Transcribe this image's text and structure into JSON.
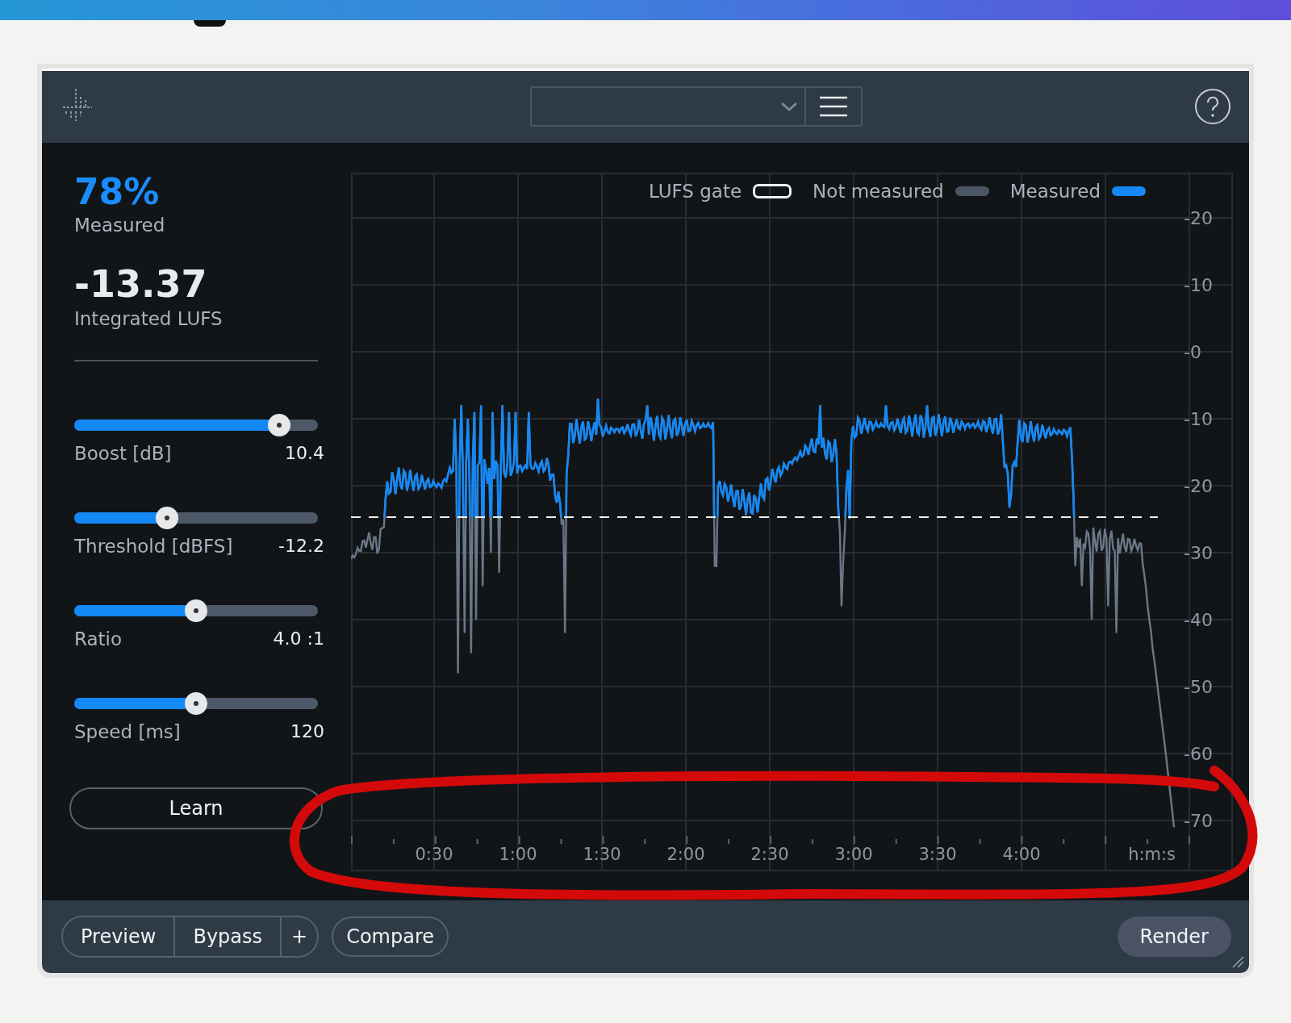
{
  "stats": {
    "percent": "78%",
    "percent_label": "Measured",
    "value": "-13.37",
    "value_label": "Integrated LUFS"
  },
  "sliders": [
    {
      "label": "Boost [dB]",
      "value": "10.4",
      "level": 0.84
    },
    {
      "label": "Threshold [dBFS]",
      "value": "-12.2",
      "level": 0.38
    },
    {
      "label": "Ratio",
      "value": "4.0 :1",
      "level": 0.5
    },
    {
      "label": "Speed [ms]",
      "value": "120",
      "level": 0.5
    }
  ],
  "learn_button": "Learn",
  "chart": {
    "legend": [
      {
        "label": "LUFS gate",
        "kind": "gate"
      },
      {
        "label": "Not measured",
        "kind": "unmeasured"
      },
      {
        "label": "Measured",
        "kind": "measured"
      }
    ],
    "y_labels": [
      "-20",
      "-10",
      "-0",
      "-10",
      "-20",
      "-30",
      "-40",
      "-50",
      "-60",
      "-70"
    ],
    "x_labels": [
      "0:30",
      "1:00",
      "1:30",
      "2:00",
      "2:30",
      "3:00",
      "3:30",
      "4:00"
    ],
    "x_unit": "h:m:s"
  },
  "footer": {
    "group": [
      "Preview",
      "Bypass",
      "+"
    ],
    "compare": "Compare",
    "render": "Render"
  }
}
